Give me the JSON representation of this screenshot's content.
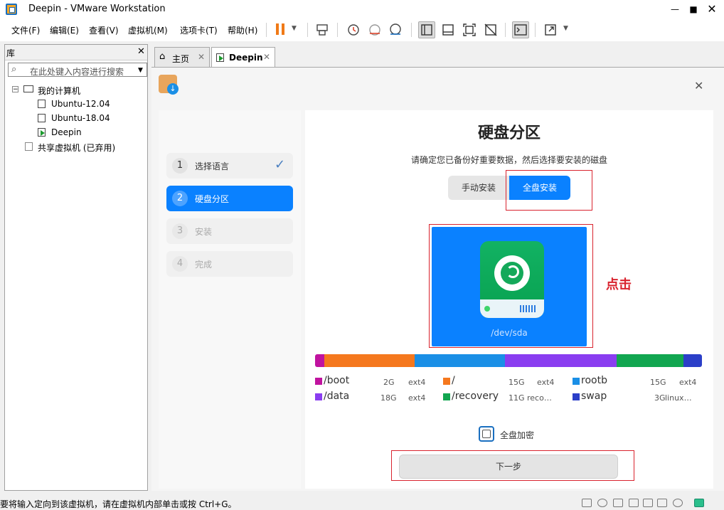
{
  "window": {
    "title": "Deepin - VMware Workstation"
  },
  "menubar": {
    "items": [
      "文件(F)",
      "编辑(E)",
      "查看(V)",
      "虚拟机(M)",
      "选项卡(T)",
      "帮助(H)"
    ]
  },
  "library": {
    "title": "库",
    "search_placeholder": "在此处键入内容进行搜索",
    "tree": {
      "root": "我的计算机",
      "vms": [
        "Ubuntu-12.04",
        "Ubuntu-18.04",
        "Deepin"
      ],
      "shared": "共享虚拟机 (已弃用)"
    }
  },
  "tabs": [
    {
      "label": "主页"
    },
    {
      "label": "Deepin"
    }
  ],
  "installer": {
    "steps": [
      {
        "num": "1",
        "label": "选择语言"
      },
      {
        "num": "2",
        "label": "硬盘分区"
      },
      {
        "num": "3",
        "label": "安装"
      },
      {
        "num": "4",
        "label": "完成"
      }
    ],
    "title": "硬盘分区",
    "subtitle": "请确定您已备份好重要数据，然后选择要安装的磁盘",
    "mode_manual": "手动安装",
    "mode_full": "全盘安装",
    "disk_label": "/dev/sda",
    "annotation": "点击",
    "partition_bar_colors": [
      "#c0139f",
      "#f5781e",
      "#1a8fe6",
      "#8a3df0",
      "#12a650",
      "#2b3fc8"
    ],
    "partitions": [
      {
        "name": "/boot",
        "size": "2G",
        "fs": "ext4",
        "color": "#c0139f"
      },
      {
        "name": "/",
        "size": "15G",
        "fs": "ext4",
        "color": "#f5781e"
      },
      {
        "name": "rootb",
        "size": "15G",
        "fs": "ext4",
        "color": "#1a8fe6"
      },
      {
        "name": "/data",
        "size": "18G",
        "fs": "ext4",
        "color": "#8a3df0"
      },
      {
        "name": "/recovery",
        "size": "11G",
        "fs": "reco…",
        "color": "#12a650"
      },
      {
        "name": "swap",
        "size": "3G",
        "fs": "linux…",
        "color": "#2b3fc8"
      }
    ],
    "encrypt_label": "全盘加密",
    "next_label": "下一步"
  },
  "statusbar": {
    "text": "要将输入定向到该虚拟机，请在虚拟机内部单击或按 Ctrl+G。"
  },
  "colors": {
    "accent": "#0a81ff",
    "annotation_red": "#d9232e"
  }
}
